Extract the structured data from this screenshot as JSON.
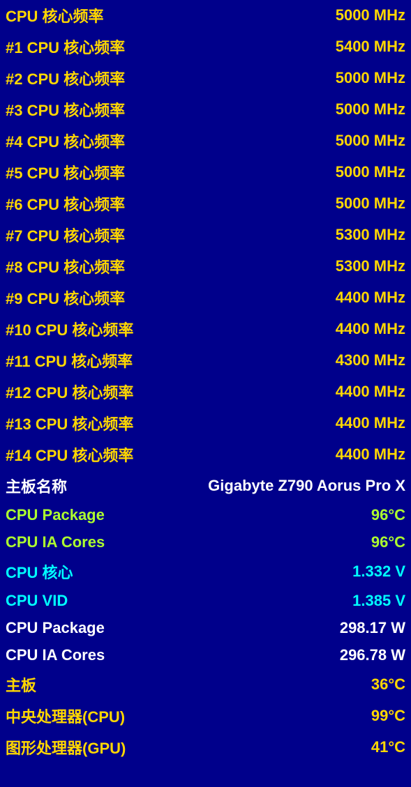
{
  "rows": [
    {
      "id": "cpu-core-freq",
      "label": "CPU 核心频率",
      "value": "5000 MHz",
      "colorClass": "row-yellow"
    },
    {
      "id": "cpu-core-1",
      "label": "#1 CPU 核心频率",
      "value": "5400 MHz",
      "colorClass": "row-yellow"
    },
    {
      "id": "cpu-core-2",
      "label": "#2 CPU 核心频率",
      "value": "5000 MHz",
      "colorClass": "row-yellow"
    },
    {
      "id": "cpu-core-3",
      "label": "#3 CPU 核心频率",
      "value": "5000 MHz",
      "colorClass": "row-yellow"
    },
    {
      "id": "cpu-core-4",
      "label": "#4 CPU 核心频率",
      "value": "5000 MHz",
      "colorClass": "row-yellow"
    },
    {
      "id": "cpu-core-5",
      "label": "#5 CPU 核心频率",
      "value": "5000 MHz",
      "colorClass": "row-yellow"
    },
    {
      "id": "cpu-core-6",
      "label": "#6 CPU 核心频率",
      "value": "5000 MHz",
      "colorClass": "row-yellow"
    },
    {
      "id": "cpu-core-7",
      "label": "#7 CPU 核心频率",
      "value": "5300 MHz",
      "colorClass": "row-yellow"
    },
    {
      "id": "cpu-core-8",
      "label": "#8 CPU 核心频率",
      "value": "5300 MHz",
      "colorClass": "row-yellow"
    },
    {
      "id": "cpu-core-9",
      "label": "#9 CPU 核心频率",
      "value": "4400 MHz",
      "colorClass": "row-yellow"
    },
    {
      "id": "cpu-core-10",
      "label": "#10 CPU 核心频率",
      "value": "4400 MHz",
      "colorClass": "row-yellow"
    },
    {
      "id": "cpu-core-11",
      "label": "#11 CPU 核心频率",
      "value": "4300 MHz",
      "colorClass": "row-yellow"
    },
    {
      "id": "cpu-core-12",
      "label": "#12 CPU 核心频率",
      "value": "4400 MHz",
      "colorClass": "row-yellow"
    },
    {
      "id": "cpu-core-13",
      "label": "#13 CPU 核心频率",
      "value": "4400 MHz",
      "colorClass": "row-yellow"
    },
    {
      "id": "cpu-core-14",
      "label": "#14 CPU 核心频率",
      "value": "4400 MHz",
      "colorClass": "row-yellow"
    },
    {
      "id": "mobo-name",
      "label": "主板名称",
      "value": "Gigabyte Z790 Aorus Pro X",
      "colorClass": "row-white"
    },
    {
      "id": "cpu-package-temp",
      "label": "CPU Package",
      "value": "96°C",
      "colorClass": "row-green-yellow"
    },
    {
      "id": "cpu-ia-cores-temp",
      "label": "CPU IA Cores",
      "value": "96°C",
      "colorClass": "row-green-yellow"
    },
    {
      "id": "cpu-core-voltage",
      "label": "CPU 核心",
      "value": "1.332 V",
      "colorClass": "row-cyan"
    },
    {
      "id": "cpu-vid",
      "label": "CPU VID",
      "value": "1.385 V",
      "colorClass": "row-cyan"
    },
    {
      "id": "cpu-package-power",
      "label": "CPU Package",
      "value": "298.17 W",
      "colorClass": "row-white"
    },
    {
      "id": "cpu-ia-cores-power",
      "label": "CPU IA Cores",
      "value": "296.78 W",
      "colorClass": "row-white"
    },
    {
      "id": "mobo-temp",
      "label": "主板",
      "value": "36°C",
      "colorClass": "row-yellow"
    },
    {
      "id": "cpu-temp",
      "label": "中央处理器(CPU)",
      "value": "99°C",
      "colorClass": "row-yellow"
    },
    {
      "id": "gpu-temp",
      "label": "图形处理器(GPU)",
      "value": "41°C",
      "colorClass": "row-yellow"
    }
  ]
}
